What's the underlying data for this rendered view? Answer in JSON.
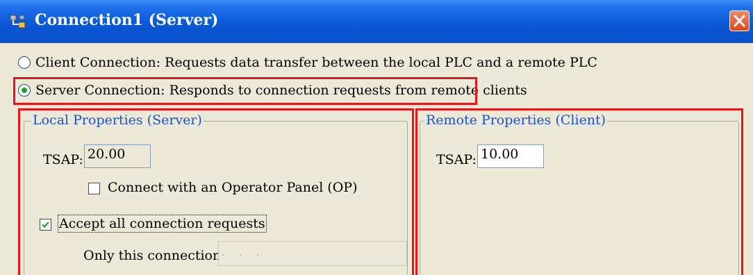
{
  "window": {
    "title": "Connection1 (Server)"
  },
  "connection_type": {
    "client_label": "Client Connection: Requests data transfer between the local PLC and a remote PLC",
    "server_label": "Server Connection: Responds to connection requests from remote clients",
    "selected": "server"
  },
  "local": {
    "legend": "Local Properties (Server)",
    "tsap_label": "TSAP:",
    "tsap_value": "20.00",
    "op_label": "Connect with an Operator Panel (OP)",
    "op_checked": false,
    "accept_label": "Accept all connection requests",
    "accept_checked": true,
    "only_label": "Only this connection:",
    "only_value": ". . ."
  },
  "remote": {
    "legend": "Remote Properties (Client)",
    "tsap_label": "TSAP:",
    "tsap_value": "10.00"
  },
  "colors": {
    "highlight": "#e8151b",
    "legend_text": "#1e50c8",
    "title_bar": "#0a58d6",
    "dialog_bg": "#ece9d8"
  },
  "icons": {
    "app": "connection-icon",
    "close": "close-icon",
    "check": "check-icon"
  }
}
